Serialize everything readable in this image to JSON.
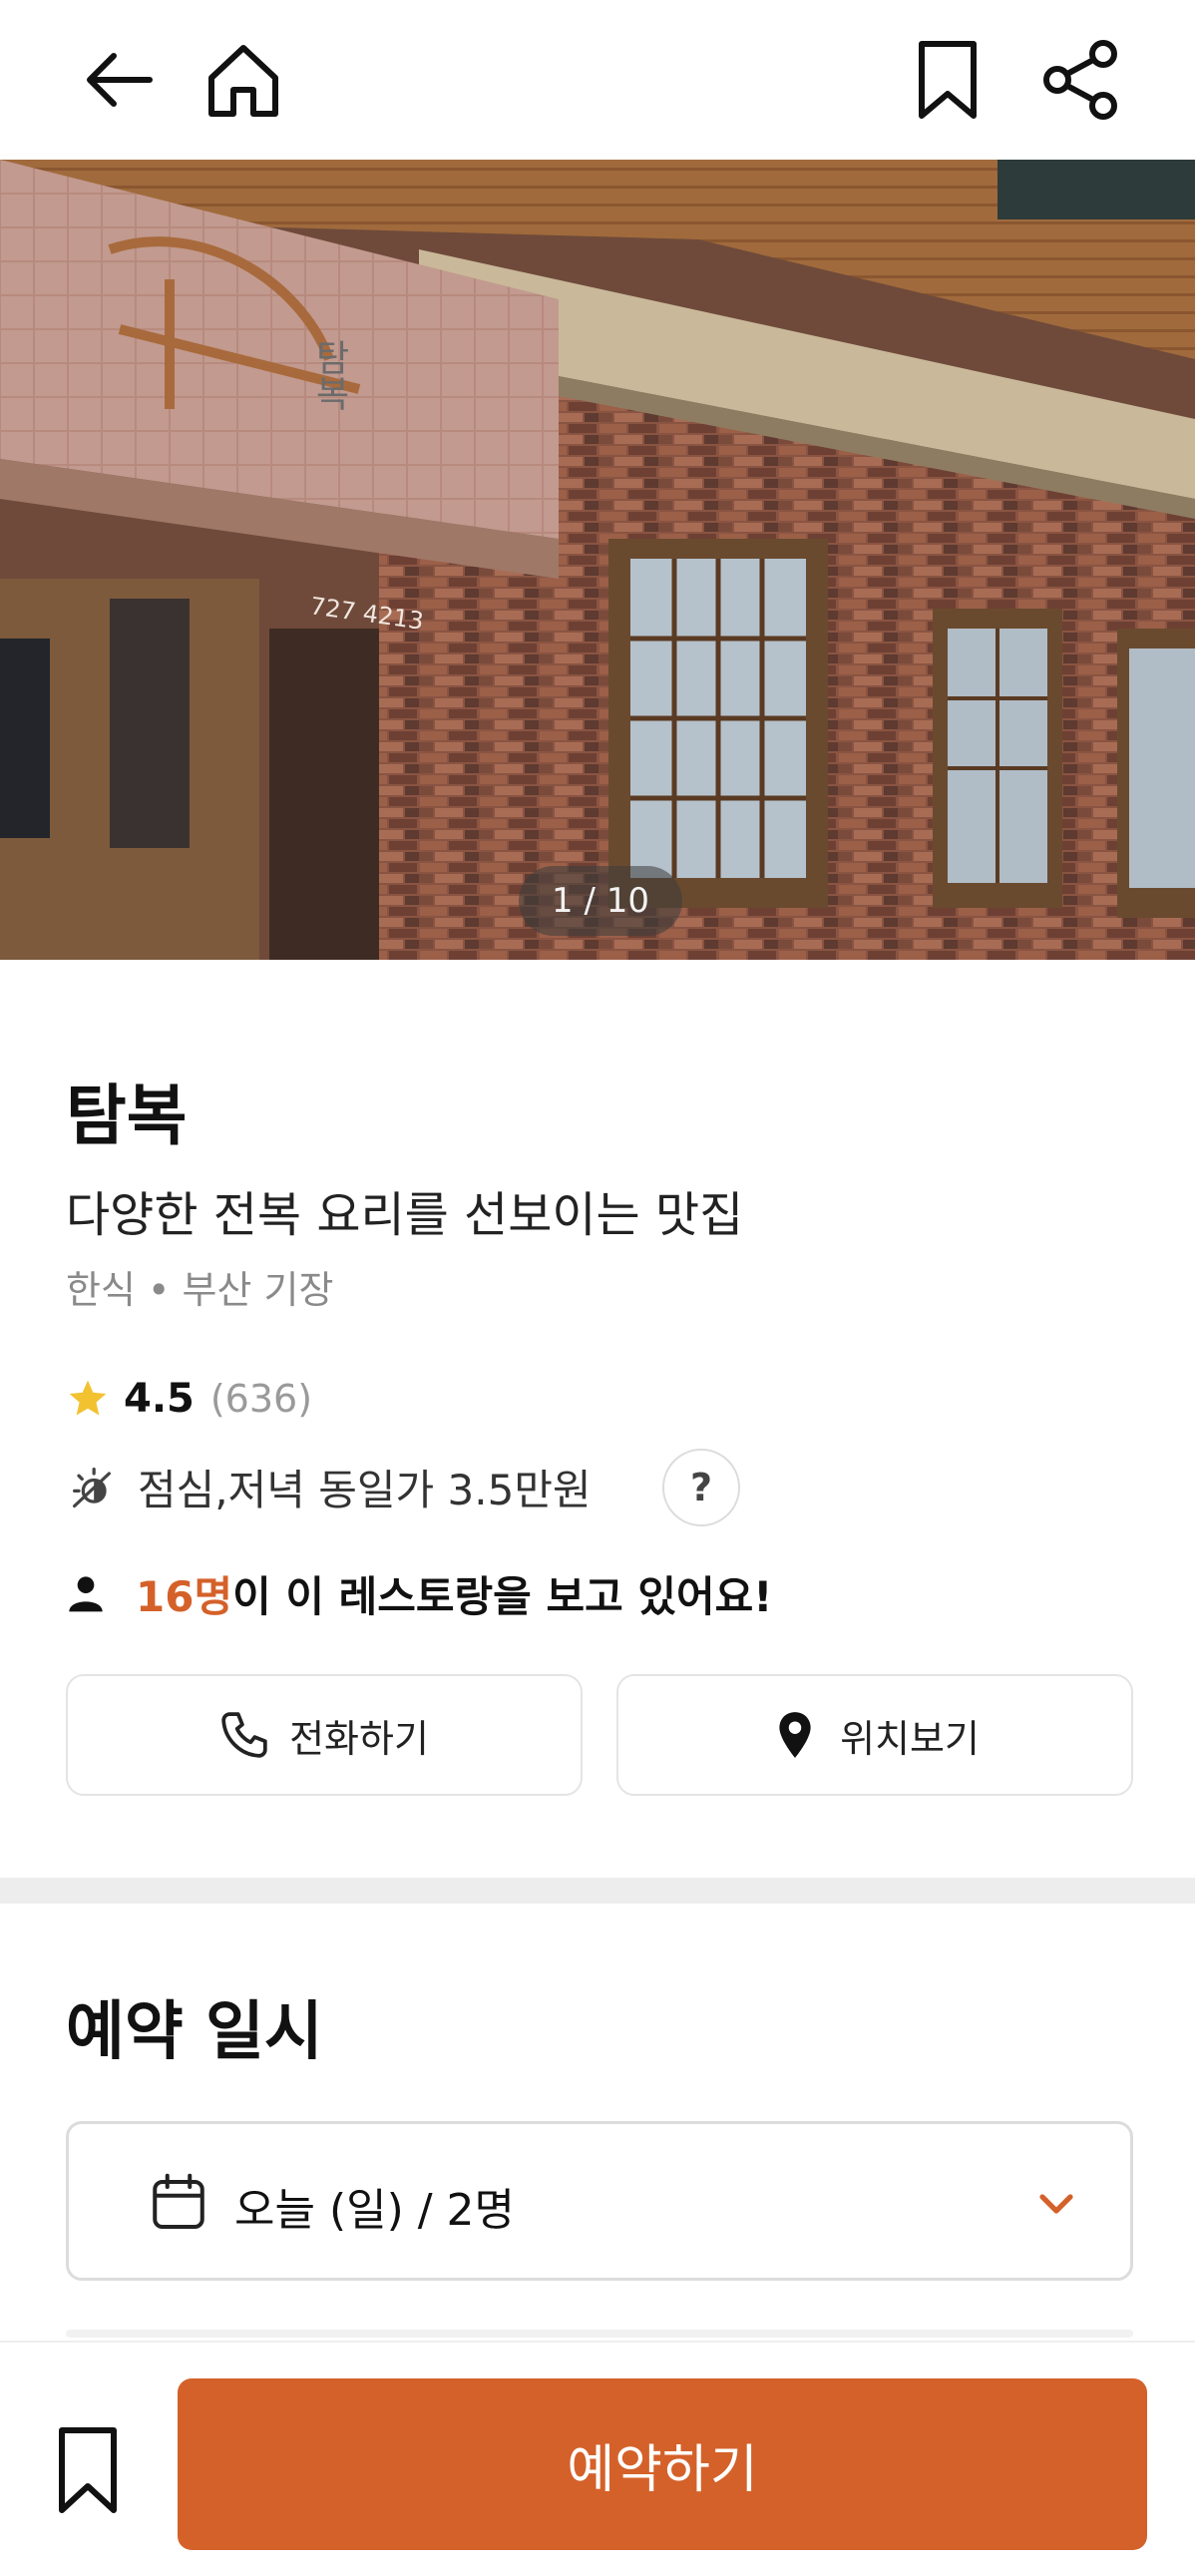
{
  "header": {
    "back_icon": "arrow-left-icon",
    "home_icon": "home-icon",
    "bookmark_icon": "bookmark-icon",
    "share_icon": "share-icon"
  },
  "hero": {
    "counter": "1 / 10",
    "sign_phone": "727 4213",
    "sign_text": "탐복"
  },
  "restaurant": {
    "name": "탐복",
    "description": "다양한 전복 요리를 선보이는 맛집",
    "category": "한식 • 부산 기장",
    "rating": "4.5",
    "review_count": "(636)",
    "price_info": "점심,저녁 동일가 3.5만원",
    "help_label": "?",
    "viewers_count": "16명",
    "viewers_text": "이 이 레스토랑을 보고 있어요!"
  },
  "actions": {
    "call_label": "전화하기",
    "location_label": "위치보기"
  },
  "reservation": {
    "section_title": "예약 일시",
    "selected_value": "오늘 (일) / 2명"
  },
  "bottom": {
    "reserve_label": "예약하기"
  },
  "colors": {
    "accent": "#d4612a",
    "star": "#f2c230",
    "divider": "#ededed"
  }
}
